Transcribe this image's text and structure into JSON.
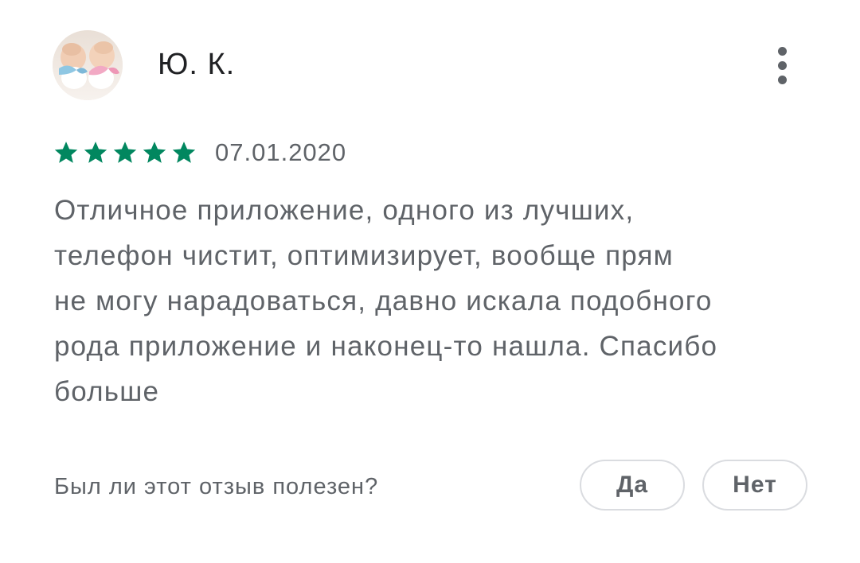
{
  "review": {
    "author": "Ю. К.",
    "rating": 5,
    "rating_max": 5,
    "date": "07.01.2020",
    "text_lines": [
      "Отличное приложение, одного из лучших,",
      "телефон чистит, оптимизирует, вообще прям",
      "не могу нарадоваться, давно искала подобного",
      "рода приложение и наконец-то нашла. Спасибо",
      "больше"
    ]
  },
  "feedback": {
    "question": "Был ли этот отзыв полезен?",
    "yes_label": "Да",
    "no_label": "Нет"
  },
  "icons": {
    "more": "more-vert-icon",
    "star": "star-icon",
    "avatar": "avatar-photo"
  },
  "colors": {
    "star": "#01875f",
    "text_secondary": "#5f6368",
    "text_primary": "#202124",
    "button_border": "#dadce0"
  }
}
